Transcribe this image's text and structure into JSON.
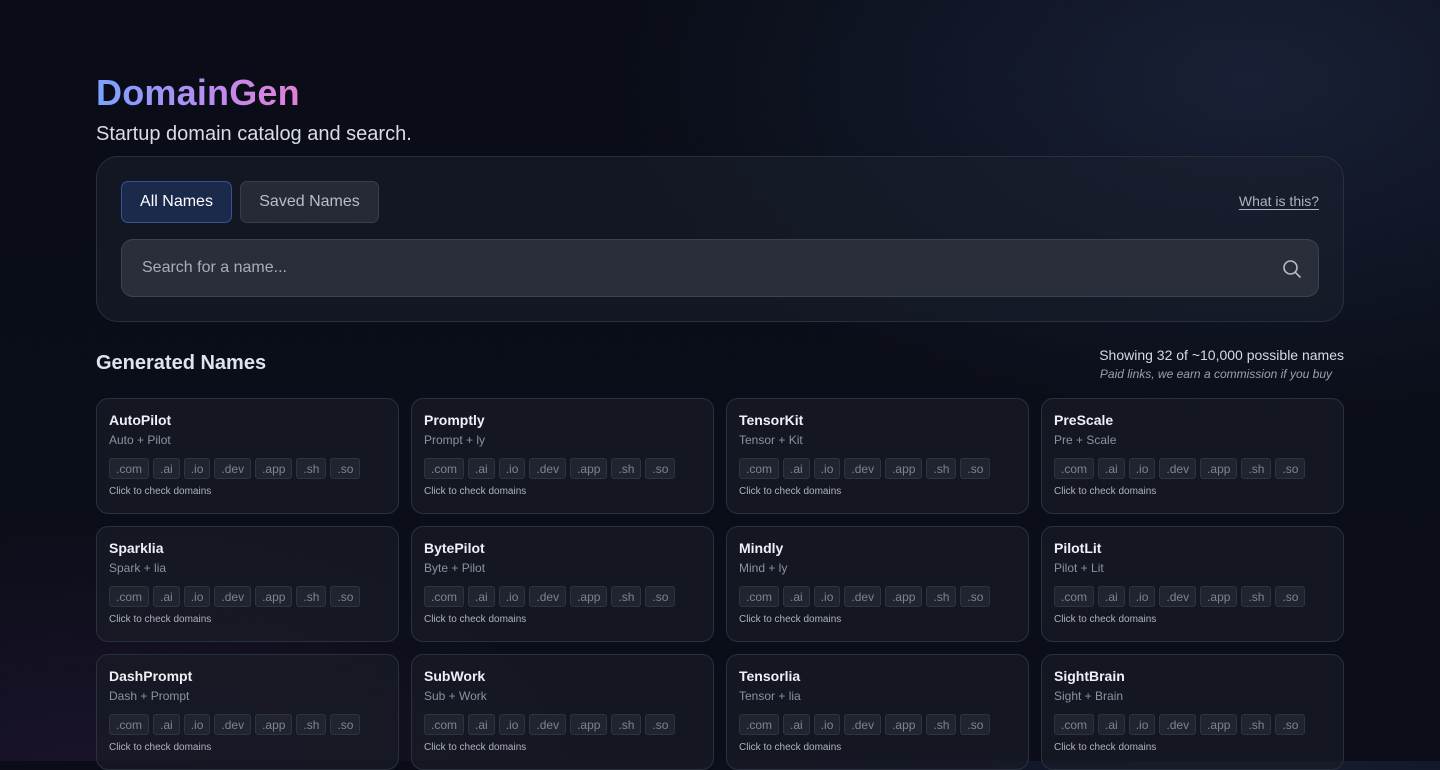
{
  "header": {
    "logo": "DomainGen",
    "tagline": "Startup domain catalog and search."
  },
  "tabs": {
    "all_label": "All Names",
    "saved_label": "Saved Names"
  },
  "help_link": "What is this?",
  "search": {
    "placeholder": "Search for a name..."
  },
  "results": {
    "title": "Generated Names",
    "showing": "Showing 32 of ~10,000 possible names",
    "disclaimer": "Paid links, we earn a commission if you buy"
  },
  "tlds": [
    ".com",
    ".ai",
    ".io",
    ".dev",
    ".app",
    ".sh",
    ".so"
  ],
  "card_hint": "Click to check domains",
  "cards": [
    {
      "name": "AutoPilot",
      "parts": "Auto + Pilot"
    },
    {
      "name": "Promptly",
      "parts": "Prompt + ly"
    },
    {
      "name": "TensorKit",
      "parts": "Tensor + Kit"
    },
    {
      "name": "PreScale",
      "parts": "Pre + Scale"
    },
    {
      "name": "Sparklia",
      "parts": "Spark + lia"
    },
    {
      "name": "BytePilot",
      "parts": "Byte + Pilot"
    },
    {
      "name": "Mindly",
      "parts": "Mind + ly"
    },
    {
      "name": "PilotLit",
      "parts": "Pilot + Lit"
    },
    {
      "name": "DashPrompt",
      "parts": "Dash + Prompt"
    },
    {
      "name": "SubWork",
      "parts": "Sub + Work"
    },
    {
      "name": "Tensorlia",
      "parts": "Tensor + lia"
    },
    {
      "name": "SightBrain",
      "parts": "Sight + Brain"
    }
  ],
  "colors": {
    "background": "#0a0d17",
    "accent_tab": "#1b2a4b",
    "logo_gradient": [
      "#7aa2ff",
      "#b98cf0",
      "#e37fd6"
    ]
  }
}
